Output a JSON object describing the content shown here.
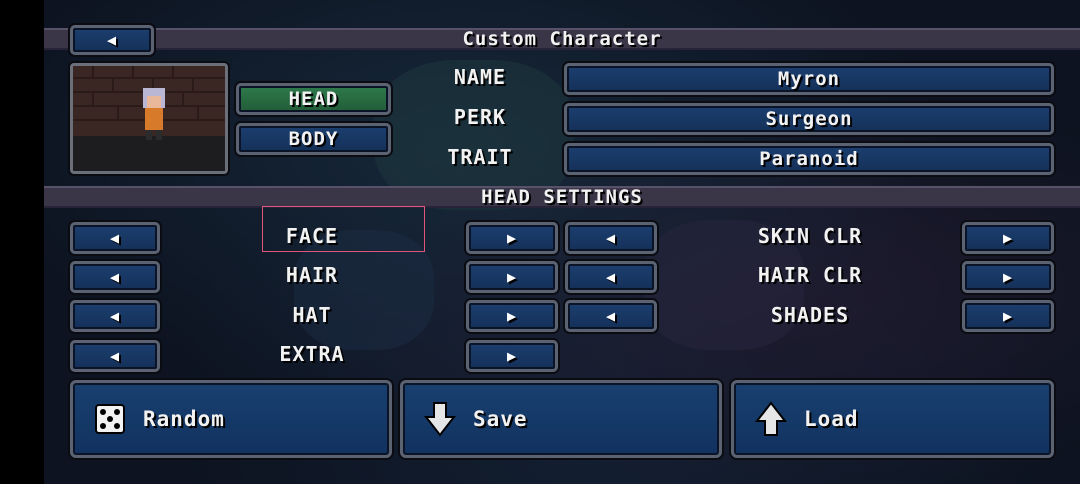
{
  "header": {
    "title": "Custom Character",
    "back_icon": "left-arrow-icon"
  },
  "tabs": [
    {
      "label": "HEAD",
      "active": true
    },
    {
      "label": "BODY",
      "active": false
    }
  ],
  "profile": [
    {
      "field": "NAME",
      "value": "Myron"
    },
    {
      "field": "PERK",
      "value": "Surgeon"
    },
    {
      "field": "TRAIT",
      "value": "Paranoid"
    }
  ],
  "section_title": "HEAD SETTINGS",
  "settings_left": [
    {
      "label": "FACE"
    },
    {
      "label": "HAIR"
    },
    {
      "label": "HAT"
    },
    {
      "label": "EXTRA"
    }
  ],
  "settings_right": [
    {
      "label": "SKIN CLR"
    },
    {
      "label": "HAIR CLR"
    },
    {
      "label": "SHADES"
    }
  ],
  "actions": [
    {
      "label": "Random",
      "icon": "dice-icon"
    },
    {
      "label": "Save",
      "icon": "down-arrow-icon"
    },
    {
      "label": "Load",
      "icon": "up-arrow-icon"
    }
  ],
  "colors": {
    "button_blue": "#17355f",
    "button_green": "#2f7a4c",
    "border": "#5b6373"
  },
  "glyphs": {
    "left": "◀",
    "right": "▶"
  }
}
